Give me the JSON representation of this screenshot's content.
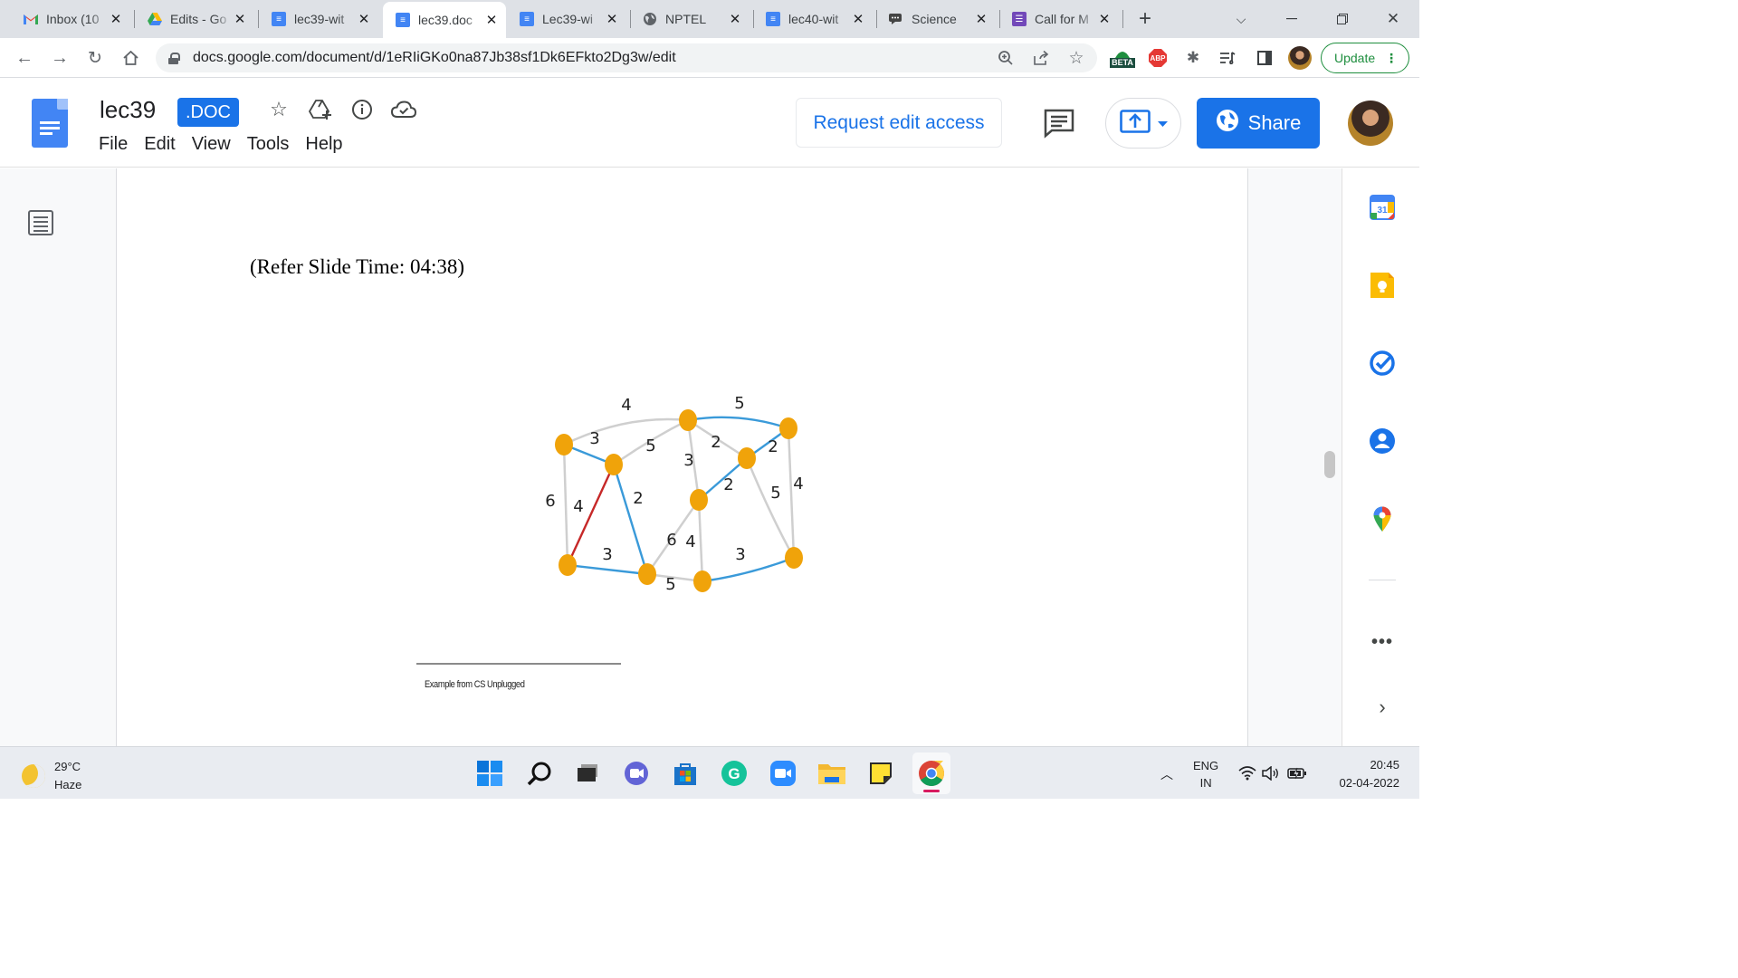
{
  "browser": {
    "tabs": [
      {
        "title": "Inbox (10",
        "icon": "gmail-icon",
        "active": false
      },
      {
        "title": "Edits - Go",
        "icon": "google-drive-icon",
        "active": false
      },
      {
        "title": "lec39-wit",
        "icon": "google-docs-icon",
        "active": false
      },
      {
        "title": "lec39.doc",
        "icon": "google-docs-icon",
        "active": true
      },
      {
        "title": "Lec39-wi",
        "icon": "google-docs-icon",
        "active": false
      },
      {
        "title": "NPTEL",
        "icon": "globe-icon",
        "active": false
      },
      {
        "title": "lec40-wit",
        "icon": "google-docs-icon",
        "active": false
      },
      {
        "title": "Science",
        "icon": "chat-icon",
        "active": false
      },
      {
        "title": "Call for M",
        "icon": "google-forms-icon",
        "active": false
      }
    ],
    "url": "docs.google.com/document/d/1eRIiGKo0na87Jb38sf1Dk6EFkto2Dg3w/edit",
    "update_label": "Update",
    "beta_label": "BETA",
    "abp_label": "ABP"
  },
  "docs": {
    "title": "lec39",
    "badge": ".DOC",
    "menu": [
      "File",
      "Edit",
      "View",
      "Tools",
      "Help"
    ],
    "request_edit_label": "Request edit access",
    "share_label": "Share"
  },
  "document": {
    "refer_line": "(Refer Slide Time: 04:38)",
    "footnote": "Example from CS Unplugged",
    "graph": {
      "edge_labels": [
        "4",
        "5",
        "3",
        "5",
        "3",
        "2",
        "2",
        "2",
        "6",
        "4",
        "2",
        "5",
        "4",
        "6",
        "4",
        "3",
        "3",
        "5"
      ]
    }
  },
  "sidepanel": {
    "calendar_day": "31"
  },
  "taskbar": {
    "weather_temp": "29°C",
    "weather_desc": "Haze",
    "lang_top": "ENG",
    "lang_bottom": "IN",
    "time": "20:45",
    "date": "02-04-2022"
  },
  "colors": {
    "accent": "#1a73e8",
    "node": "#f0a30a",
    "edge_selected": "#3a9ad9",
    "edge_red": "#c62828",
    "edge_default": "#cfcfcf"
  }
}
